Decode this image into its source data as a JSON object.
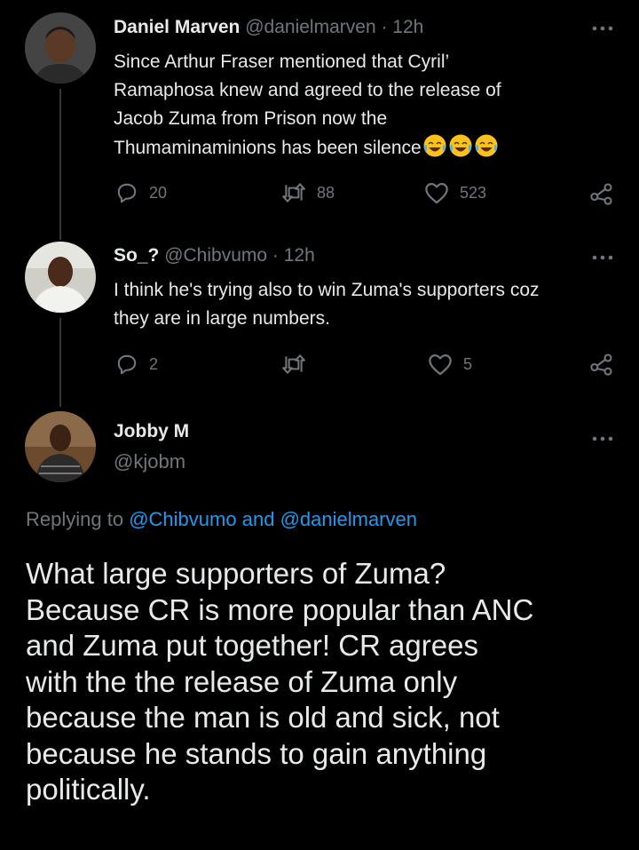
{
  "tweets": [
    {
      "name": "Daniel Marven",
      "handle": "@danielmarven",
      "time": "· 12h",
      "text_lines": [
        "Since Arthur Fraser mentioned that Cyril’",
        "Ramaphosa knew and agreed to the release of",
        "Jacob Zuma from Prison now the",
        "Thumaminaminions has been silence"
      ],
      "emojis": [
        "face-with-tears-of-joy",
        "face-with-tears-of-joy",
        "face-with-tears-of-joy"
      ],
      "replies": "20",
      "retweets": "88",
      "likes": "523"
    },
    {
      "name": "So_?",
      "handle": "@Chibvumo",
      "time": "· 12h",
      "text_lines": [
        "I think he's trying also to win Zuma's supporters coz",
        "they are in large numbers."
      ],
      "replies": "2",
      "retweets": "",
      "likes": "5"
    }
  ],
  "main_tweet": {
    "name": "Jobby M",
    "handle": "@kjobm",
    "replying_prefix": "Replying to",
    "replying_handle_1": "@Chibvumo",
    "replying_and": "and",
    "replying_handle_2": "@danielmarven",
    "text_lines": [
      "What large supporters of Zuma?",
      "Because CR is more popular than ANC",
      "and Zuma put together! CR agrees",
      "with the the release of Zuma only",
      "because the man is old and sick, not",
      "because he stands to gain anything",
      "politically."
    ]
  },
  "icons": {
    "reply": "reply-icon",
    "retweet": "retweet-icon",
    "like": "heart-icon",
    "share": "share-icon",
    "more": "more-options-icon"
  },
  "colors": {
    "background": "#000000",
    "text": "#e7e9ea",
    "muted": "#71767b",
    "link": "#1d9bf0"
  }
}
